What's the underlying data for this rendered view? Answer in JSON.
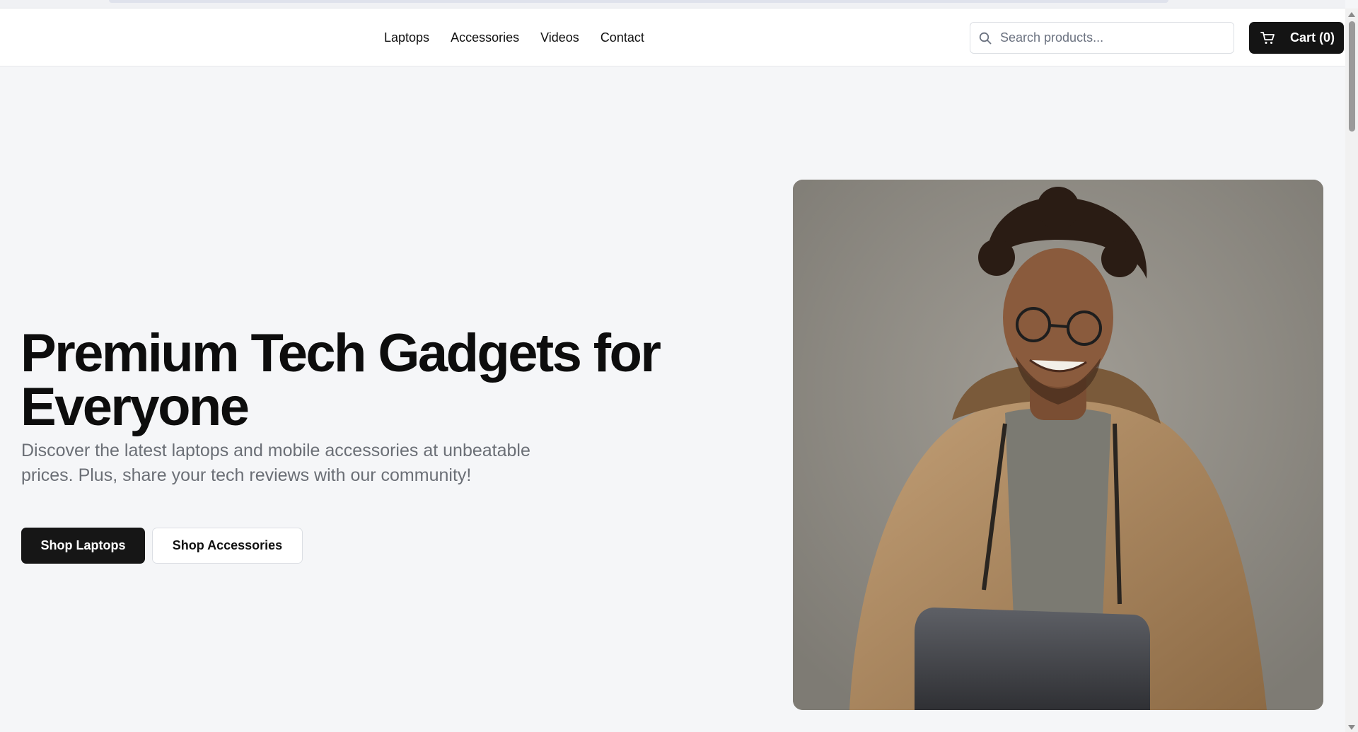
{
  "header": {
    "nav": [
      {
        "label": "Laptops"
      },
      {
        "label": "Accessories"
      },
      {
        "label": "Videos"
      },
      {
        "label": "Contact"
      }
    ],
    "search": {
      "placeholder": "Search products...",
      "value": "",
      "icon": "search-icon"
    },
    "cart": {
      "label": "Cart (0)",
      "icon": "cart-icon"
    }
  },
  "hero": {
    "title": "Premium Tech Gadgets for Everyone",
    "subtitle": "Discover the latest laptops and mobile accessories at unbeatable prices. Plus, share your tech reviews with our community!",
    "primary_button": "Shop Laptops",
    "secondary_button": "Shop Accessories",
    "image": "smiling-man-with-laptop-photo"
  },
  "colors": {
    "page_background": "#f5f6f8",
    "header_background": "#ffffff",
    "primary_button": "#161616",
    "text": "#0d0d0d",
    "subtitle_text": "#6b6f76"
  }
}
